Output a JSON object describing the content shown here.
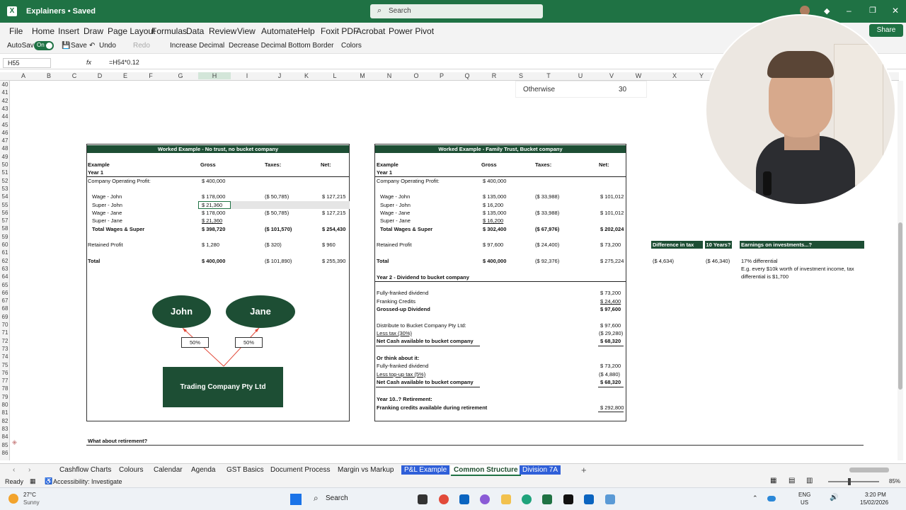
{
  "window": {
    "title": "Explainers • Saved",
    "search_placeholder": "Search",
    "share_label": "Share"
  },
  "menu": [
    "File",
    "Home",
    "Insert",
    "Draw",
    "Page Layout",
    "Formulas",
    "Data",
    "Review",
    "View",
    "Automate",
    "Help",
    "Foxit PDF",
    "Acrobat",
    "Power Pivot"
  ],
  "toolbar": {
    "autosave": "AutoSave",
    "autosave_state": "On",
    "save": "Save",
    "undo": "Undo",
    "redo": "Redo",
    "increase_decimal": "Increase Decimal",
    "decrease_decimal": "Decrease Decimal",
    "bottom_border": "Bottom Border",
    "colors": "Colors"
  },
  "formula": {
    "namebox": "H55",
    "fx": "fx",
    "content": "=H54*0.12"
  },
  "columns": [
    "A",
    "B",
    "C",
    "D",
    "E",
    "F",
    "G",
    "H",
    "I",
    "J",
    "K",
    "L",
    "M",
    "N",
    "O",
    "P",
    "Q",
    "R",
    "S",
    "T",
    "U",
    "V",
    "W",
    "X",
    "Y"
  ],
  "rows": [
    "40",
    "41",
    "42",
    "43",
    "44",
    "45",
    "46",
    "47",
    "48",
    "49",
    "50",
    "51",
    "52",
    "53",
    "54",
    "55",
    "56",
    "57",
    "58",
    "59",
    "60",
    "61",
    "62",
    "63",
    "64",
    "65",
    "66",
    "67",
    "68",
    "69",
    "70",
    "71",
    "72",
    "73",
    "74",
    "75",
    "76",
    "77",
    "78",
    "79",
    "80",
    "81",
    "82",
    "83",
    "84",
    "85",
    "86"
  ],
  "otherwise": {
    "label": "Otherwise",
    "value": "30"
  },
  "left": {
    "header": "Worked Example - No trust, no bucket company",
    "col_example": "Example",
    "col_gross": "Gross",
    "col_taxes": "Taxes:",
    "col_net": "Net:",
    "year": "Year 1",
    "rows": [
      {
        "label": "Company Operating Profit:",
        "gross": "$   400,000",
        "taxes": "",
        "net": ""
      },
      {
        "label": "Wage - John",
        "gross": "$   178,000",
        "taxes": "($   50,785)",
        "net": "$   127,215"
      },
      {
        "label": "Super - John",
        "gross": "$     21,360",
        "taxes": "",
        "net": ""
      },
      {
        "label": "Wage - Jane",
        "gross": "$   178,000",
        "taxes": "($   50,785)",
        "net": "$   127,215"
      },
      {
        "label": "Super - Jane",
        "gross": "$     21,360",
        "taxes": "",
        "net": ""
      },
      {
        "label": "Total Wages & Super",
        "gross": "$   398,720",
        "taxes": "($ 101,570)",
        "net": "$   254,430"
      },
      {
        "label": "Retained Profit",
        "gross": "$       1,280",
        "taxes": "($         320)",
        "net": "$          960"
      },
      {
        "label": "Total",
        "gross": "$   400,000",
        "taxes": "($ 101,890)",
        "net": "$   255,390"
      }
    ],
    "diagram": {
      "john": "John",
      "jane": "Jane",
      "pct_john": "50%",
      "pct_jane": "50%",
      "company": "Trading Company Pty Ltd"
    }
  },
  "right": {
    "header": "Worked Example - Family Trust, Bucket company",
    "col_example": "Example",
    "col_gross": "Gross",
    "col_taxes": "Taxes:",
    "col_net": "Net:",
    "year": "Year 1",
    "rows": [
      {
        "label": "Company Operating Profit:",
        "gross": "$ 400,000",
        "taxes": "",
        "net": ""
      },
      {
        "label": "Wage - John",
        "gross": "$ 135,000",
        "taxes": "($   33,988)",
        "net": "$ 101,012"
      },
      {
        "label": "Super - John",
        "gross": "$   16,200",
        "taxes": "",
        "net": ""
      },
      {
        "label": "Wage - Jane",
        "gross": "$ 135,000",
        "taxes": "($   33,988)",
        "net": "$ 101,012"
      },
      {
        "label": "Super - Jane",
        "gross": "$   16,200",
        "taxes": "",
        "net": ""
      },
      {
        "label": "Total Wages & Super",
        "gross": "$ 302,400",
        "taxes": "($   67,976)",
        "net": "$ 202,024"
      },
      {
        "label": "Retained Profit",
        "gross": "$   97,600",
        "taxes": "($   24,400)",
        "net": "$   73,200"
      },
      {
        "label": "Total",
        "gross": "$ 400,000",
        "taxes": "($   92,376)",
        "net": "$ 275,224"
      }
    ],
    "year2": "Year 2 - Dividend to bucket company",
    "y2rows": [
      {
        "label": "Fully-franked dividend",
        "value": "$   73,200"
      },
      {
        "label": "Franking Credits",
        "value": "$   24,400"
      },
      {
        "label": "Grossed-up Dividend",
        "value": "$   97,600"
      },
      {
        "label": "Distribute to Bucket Company Pty Ltd:",
        "value": "$   97,600"
      },
      {
        "label": "Less tax (30%)",
        "value": "($  29,280)"
      },
      {
        "label": "Net Cash available to bucket company",
        "value": "$   68,320"
      },
      {
        "label": "Or think about it:",
        "value": ""
      },
      {
        "label": "Fully-franked dividend",
        "value": "$   73,200"
      },
      {
        "label": "Less top-up tax (5%)",
        "value": "($    4,880)"
      },
      {
        "label": "Net Cash available to bucket company",
        "value": "$   68,320"
      },
      {
        "label": "Year 10..? Retirement:",
        "value": ""
      },
      {
        "label": "Franking credits available during retirement",
        "value": "$ 292,800"
      }
    ]
  },
  "side": {
    "diff_header": "Difference in tax",
    "years_header": "10 Years?",
    "earn_header": "Earnings on investments...?",
    "diff_value": "($          4,634)",
    "years_value": "($ 46,340)",
    "earn_line1": "17% differential",
    "earn_line2": "E.g. every $10k worth of investment income, tax",
    "earn_line3": "differential is $1,700"
  },
  "retirement": "What about retirement?",
  "sheets": [
    "Cashflow Charts",
    "Colours",
    "Calendar",
    "Agenda",
    "GST Basics",
    "Document Process",
    "Margin vs Markup",
    "P&L Example",
    "Common Structure",
    "Division 7A"
  ],
  "status": {
    "ready": "Ready",
    "accessibility": "Accessibility: Investigate",
    "zoom": "85%"
  },
  "taskbar": {
    "temp": "27°C",
    "weather": "Sunny",
    "search": "Search",
    "lang1": "ENG",
    "lang2": "US",
    "time": "3:20 PM",
    "date": "15/02/2026"
  },
  "colors": {
    "excel_green": "#1f7244",
    "panel_header": "#1d4e34",
    "active_tab": "#2f5fd8"
  }
}
